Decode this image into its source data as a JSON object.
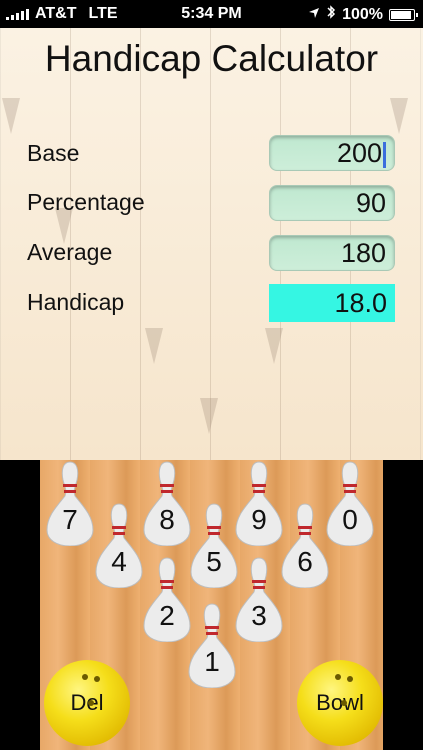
{
  "status_bar": {
    "carrier": "AT&T",
    "network": "LTE",
    "time": "5:34 PM",
    "battery": "100%",
    "battery_level": 1.0,
    "icons": [
      "signal-icon",
      "location-arrow-icon",
      "bluetooth-icon",
      "battery-icon"
    ]
  },
  "calculator": {
    "title": "Handicap Calculator",
    "fields": {
      "base": {
        "label": "Base",
        "value": "200"
      },
      "percentage": {
        "label": "Percentage",
        "value": "90"
      },
      "average": {
        "label": "Average",
        "value": "180"
      },
      "handicap": {
        "label": "Handicap",
        "value": "18.0"
      }
    }
  },
  "keypad": {
    "pins": {
      "k7": "7",
      "k8": "8",
      "k9": "9",
      "k0": "0",
      "k4": "4",
      "k5": "5",
      "k6": "6",
      "k2": "2",
      "k3": "3",
      "k1": "1"
    },
    "delete_label": "Del",
    "bowl_label": "Bowl"
  },
  "colors": {
    "result_bg": "#35f6e3",
    "input_bg": "#c5ebd5",
    "ball": "#f5de1a",
    "lane": "#eab070"
  }
}
